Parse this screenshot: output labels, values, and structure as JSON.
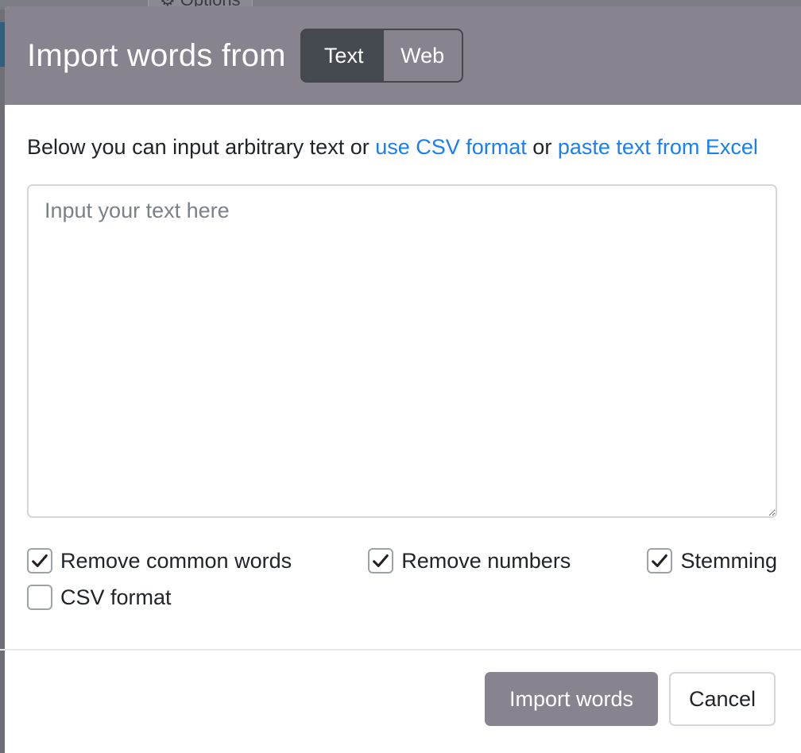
{
  "background": {
    "options_button_label": "Options",
    "options_icon": "gear-icon"
  },
  "modal": {
    "title": "Import words from",
    "source_tabs": [
      {
        "label": "Text",
        "active": true
      },
      {
        "label": "Web",
        "active": false
      }
    ],
    "intro": {
      "text_before": "Below you can input arbitrary text or ",
      "link_csv": "use CSV format",
      "text_middle": " or ",
      "link_excel": "paste text from Excel"
    },
    "textarea": {
      "placeholder": "Input your text here",
      "value": ""
    },
    "options": [
      {
        "label": "Remove common words",
        "checked": true
      },
      {
        "label": "Remove numbers",
        "checked": true
      },
      {
        "label": "Stemming",
        "checked": true
      },
      {
        "label": "CSV format",
        "checked": false
      }
    ],
    "footer": {
      "import_label": "Import words",
      "cancel_label": "Cancel"
    }
  },
  "colors": {
    "header_bg": "#878490",
    "active_tab_bg": "#454a50",
    "link": "#1a7ff0",
    "primary_button": "#878490"
  }
}
